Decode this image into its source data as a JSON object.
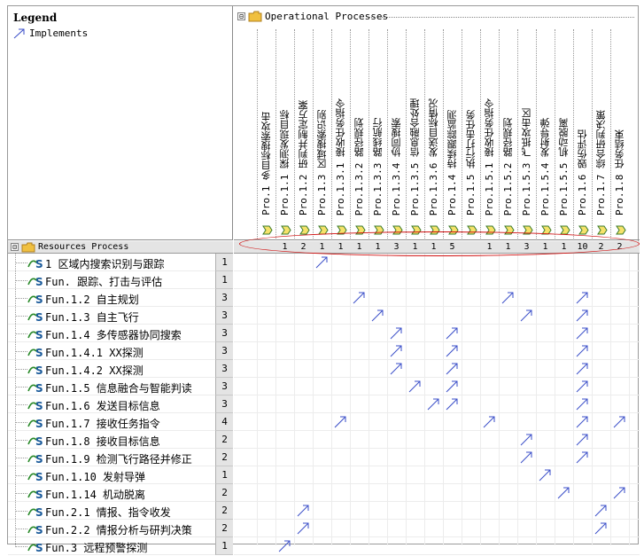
{
  "legend": {
    "title": "Legend",
    "implements_label": "Implements"
  },
  "colroot": {
    "label": "Operational Processes",
    "expander": "⊟"
  },
  "rowroot": {
    "label": "Resources Process",
    "expander": "⊟"
  },
  "columns": [
    "Pro.1 多目标搜索攻击",
    "Pro.1.1 探测发现目标",
    "Pro.1.2 研判并制定方案",
    "Pro.1.3 区域搜索识别",
    "Pro.1.3.1 接收任务指令",
    "Pro.1.3.2 路径规划",
    "Pro.1.3.3 路线航行",
    "Pro.1.3.4 协同搜索",
    "Pro.1.3.5 信息融合处理",
    "Pro.1.3.6 发送目标情况",
    "Pro.1.4 持续跟踪监测",
    "Pro.1.5 执行打击任务",
    "Pro.1.5.1 接收任务指令",
    "Pro.1.5.2 路径规划",
    "Pro.1.5.3 飞抵攻击区",
    "Pro.1.5.4 发射导弹",
    "Pro.1.5.5 机动脱离",
    "Pro.1.6 毁伤评估",
    "Pro.1.7 综合研判决策",
    "Pro.1.8 任务结束"
  ],
  "column_counts": [
    "",
    "1",
    "2",
    "1",
    "1",
    "1",
    "1",
    "3",
    "1",
    "1",
    "5",
    "",
    "1",
    "1",
    "3",
    "1",
    "1",
    "10",
    "2",
    "2"
  ],
  "rows": [
    {
      "label": "1 区域内搜索识别与跟踪",
      "count": "1",
      "marks": [
        3
      ]
    },
    {
      "label": "Fun. 跟踪、打击与评估",
      "count": "1",
      "marks": []
    },
    {
      "label": "Fun.1.2 自主规划",
      "count": "3",
      "marks": [
        5,
        13,
        17
      ]
    },
    {
      "label": "Fun.1.3 自主飞行",
      "count": "3",
      "marks": [
        6,
        14,
        17
      ]
    },
    {
      "label": "Fun.1.4 多传感器协同搜索",
      "count": "3",
      "marks": [
        7,
        10,
        17
      ]
    },
    {
      "label": "Fun.1.4.1 XX探测",
      "count": "3",
      "marks": [
        7,
        10,
        17
      ]
    },
    {
      "label": "Fun.1.4.2 XX探测",
      "count": "3",
      "marks": [
        7,
        10,
        17
      ]
    },
    {
      "label": "Fun.1.5 信息融合与智能判读",
      "count": "3",
      "marks": [
        8,
        10,
        17
      ]
    },
    {
      "label": "Fun.1.6 发送目标信息",
      "count": "3",
      "marks": [
        9,
        10,
        17
      ]
    },
    {
      "label": "Fun.1.7 接收任务指令",
      "count": "4",
      "marks": [
        4,
        12,
        17,
        19
      ]
    },
    {
      "label": "Fun.1.8 接收目标信息",
      "count": "2",
      "marks": [
        14,
        17
      ]
    },
    {
      "label": "Fun.1.9 检测飞行路径并修正",
      "count": "2",
      "marks": [
        14,
        17
      ]
    },
    {
      "label": "Fun.1.10 发射导弹",
      "count": "1",
      "marks": [
        15
      ]
    },
    {
      "label": "Fun.1.14 机动脱离",
      "count": "2",
      "marks": [
        16,
        19
      ]
    },
    {
      "label": "Fun.2.1 情报、指令收发",
      "count": "2",
      "marks": [
        2,
        18
      ]
    },
    {
      "label": "Fun.2.2 情报分析与研判决策",
      "count": "2",
      "marks": [
        2,
        18
      ]
    },
    {
      "label": "Fun.3 远程预警探测",
      "count": "1",
      "marks": [
        1
      ]
    }
  ],
  "colors": {
    "arrow": "#3a4ec8",
    "highlight": "#d01010",
    "folder": "#f0c040",
    "header_gray": "#e4e4e4"
  }
}
